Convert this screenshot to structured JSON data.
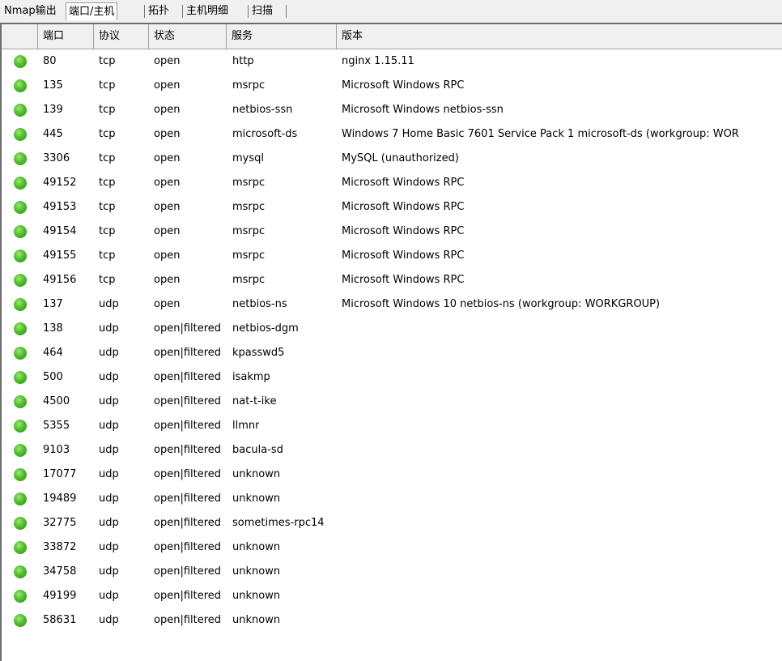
{
  "tabs": [
    {
      "label": "Nmap输出"
    },
    {
      "label": "端口/主机"
    },
    {
      "label": "拓扑"
    },
    {
      "label": "主机明细"
    },
    {
      "label": "扫描"
    }
  ],
  "columns": [
    "端口",
    "协议",
    "状态",
    "服务",
    "版本"
  ],
  "status_icon": {
    "icon": "status-open-icon",
    "color": "#3fa81f"
  },
  "rows": [
    {
      "port": "80",
      "protocol": "tcp",
      "state": "open",
      "service": "http",
      "version": "nginx 1.15.11"
    },
    {
      "port": "135",
      "protocol": "tcp",
      "state": "open",
      "service": "msrpc",
      "version": "Microsoft Windows RPC"
    },
    {
      "port": "139",
      "protocol": "tcp",
      "state": "open",
      "service": "netbios-ssn",
      "version": "Microsoft Windows netbios-ssn"
    },
    {
      "port": "445",
      "protocol": "tcp",
      "state": "open",
      "service": "microsoft-ds",
      "version": "Windows 7 Home Basic 7601 Service Pack 1 microsoft-ds (workgroup: WOR"
    },
    {
      "port": "3306",
      "protocol": "tcp",
      "state": "open",
      "service": "mysql",
      "version": "MySQL (unauthorized)"
    },
    {
      "port": "49152",
      "protocol": "tcp",
      "state": "open",
      "service": "msrpc",
      "version": "Microsoft Windows RPC"
    },
    {
      "port": "49153",
      "protocol": "tcp",
      "state": "open",
      "service": "msrpc",
      "version": "Microsoft Windows RPC"
    },
    {
      "port": "49154",
      "protocol": "tcp",
      "state": "open",
      "service": "msrpc",
      "version": "Microsoft Windows RPC"
    },
    {
      "port": "49155",
      "protocol": "tcp",
      "state": "open",
      "service": "msrpc",
      "version": "Microsoft Windows RPC"
    },
    {
      "port": "49156",
      "protocol": "tcp",
      "state": "open",
      "service": "msrpc",
      "version": "Microsoft Windows RPC"
    },
    {
      "port": "137",
      "protocol": "udp",
      "state": "open",
      "service": "netbios-ns",
      "version": "Microsoft Windows 10 netbios-ns (workgroup: WORKGROUP)"
    },
    {
      "port": "138",
      "protocol": "udp",
      "state": "open|filtered",
      "service": "netbios-dgm",
      "version": ""
    },
    {
      "port": "464",
      "protocol": "udp",
      "state": "open|filtered",
      "service": "kpasswd5",
      "version": ""
    },
    {
      "port": "500",
      "protocol": "udp",
      "state": "open|filtered",
      "service": "isakmp",
      "version": ""
    },
    {
      "port": "4500",
      "protocol": "udp",
      "state": "open|filtered",
      "service": "nat-t-ike",
      "version": ""
    },
    {
      "port": "5355",
      "protocol": "udp",
      "state": "open|filtered",
      "service": "llmnr",
      "version": ""
    },
    {
      "port": "9103",
      "protocol": "udp",
      "state": "open|filtered",
      "service": "bacula-sd",
      "version": ""
    },
    {
      "port": "17077",
      "protocol": "udp",
      "state": "open|filtered",
      "service": "unknown",
      "version": ""
    },
    {
      "port": "19489",
      "protocol": "udp",
      "state": "open|filtered",
      "service": "unknown",
      "version": ""
    },
    {
      "port": "32775",
      "protocol": "udp",
      "state": "open|filtered",
      "service": "sometimes-rpc14",
      "version": ""
    },
    {
      "port": "33872",
      "protocol": "udp",
      "state": "open|filtered",
      "service": "unknown",
      "version": ""
    },
    {
      "port": "34758",
      "protocol": "udp",
      "state": "open|filtered",
      "service": "unknown",
      "version": ""
    },
    {
      "port": "49199",
      "protocol": "udp",
      "state": "open|filtered",
      "service": "unknown",
      "version": ""
    },
    {
      "port": "58631",
      "protocol": "udp",
      "state": "open|filtered",
      "service": "unknown",
      "version": ""
    }
  ]
}
